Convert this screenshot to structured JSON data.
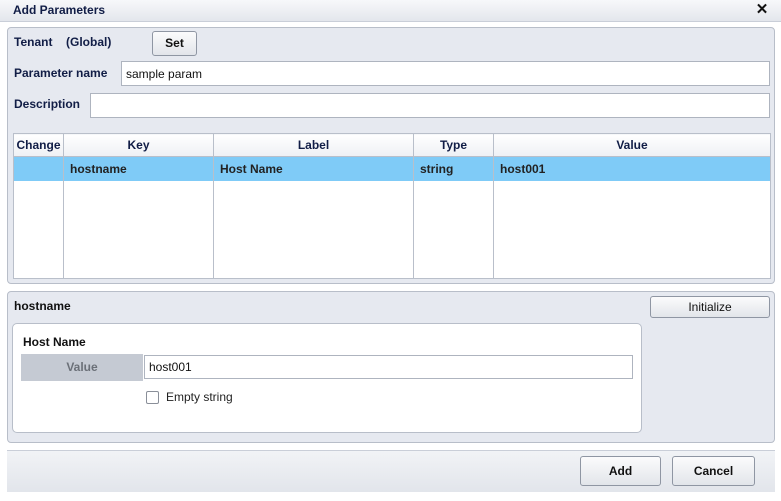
{
  "window": {
    "title": "Add Parameters",
    "close_glyph": "✕"
  },
  "tenant": {
    "label": "Tenant",
    "value": "(Global)",
    "set_button": "Set"
  },
  "parameter_name": {
    "label": "Parameter name",
    "value": "sample param"
  },
  "description": {
    "label": "Description",
    "value": ""
  },
  "table": {
    "columns": [
      "Change",
      "Key",
      "Label",
      "Type",
      "Value"
    ],
    "rows": [
      {
        "change": "",
        "key": "hostname",
        "label": "Host Name",
        "type": "string",
        "value": "host001",
        "selected": true
      }
    ]
  },
  "detail": {
    "key": "hostname",
    "initialize_button": "Initialize",
    "group_title": "Host Name",
    "value_label": "Value",
    "value": "host001",
    "empty_string_label": "Empty string",
    "empty_string_checked": false
  },
  "footer": {
    "add_button": "Add",
    "cancel_button": "Cancel"
  }
}
